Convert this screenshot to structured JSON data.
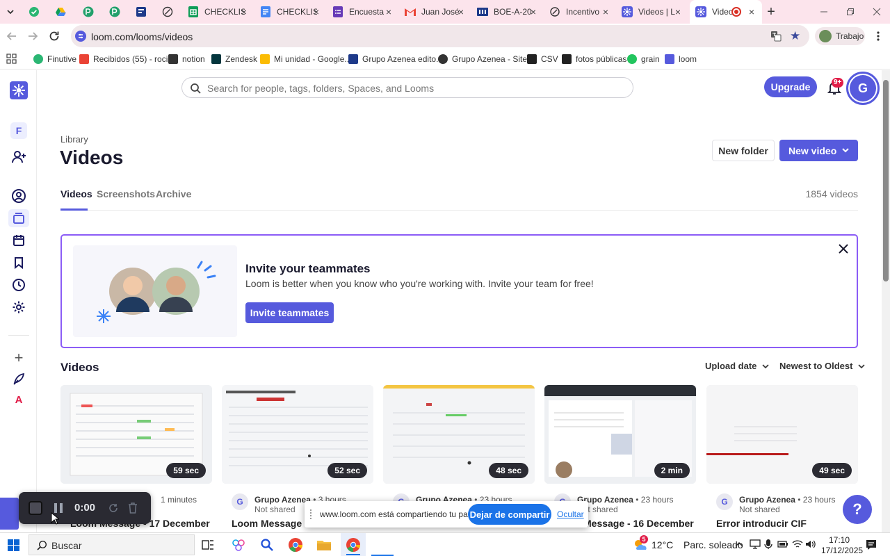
{
  "browser": {
    "tabs": [
      {
        "title": "CHECKLIS",
        "icon": "sheets-icon",
        "color": "#0f9d58"
      },
      {
        "title": "CHECKLIS",
        "icon": "docs-icon",
        "color": "#4285f4"
      },
      {
        "title": "Encuesta",
        "icon": "forms-icon",
        "color": "#673ab7"
      },
      {
        "title": "Juan José",
        "icon": "gmail-icon",
        "color": "#ea4335"
      },
      {
        "title": "BOE-A-20",
        "icon": "boe-icon",
        "color": "#1e3a8a"
      },
      {
        "title": "Incentivo",
        "icon": "globe-icon",
        "color": "#333333"
      },
      {
        "title": "Videos | L",
        "icon": "loom-icon",
        "color": "#565ADD"
      },
      {
        "title": "Video",
        "icon": "loom-icon",
        "color": "#565ADD",
        "active": true
      }
    ],
    "url": "loom.com/looms/videos",
    "profile_label": "Trabajo",
    "bookmarks": [
      {
        "label": "Finutive",
        "color": "#2bb673"
      },
      {
        "label": "Recibidos (55) - roci...",
        "color": "#ea4335"
      },
      {
        "label": "notion",
        "color": "#333333"
      },
      {
        "label": "Zendesk",
        "color": "#03363d"
      },
      {
        "label": "Mi unidad - Google...",
        "color": "#fbbc04"
      },
      {
        "label": "Grupo Azenea edito...",
        "color": "#1e3a8a"
      },
      {
        "label": "Grupo Azenea - Site...",
        "color": "#333333"
      },
      {
        "label": "CSV",
        "color": "#222222"
      },
      {
        "label": "fotos públicas",
        "color": "#222222"
      },
      {
        "label": "grain",
        "color": "#22c55e"
      },
      {
        "label": "loom",
        "color": "#565ADD"
      }
    ]
  },
  "loom": {
    "search_placeholder": "Search for people, tags, folders, Spaces, and Looms",
    "upgrade_label": "Upgrade",
    "notification_badge": "9+",
    "avatar_letter": "G",
    "workspace_letter": "F",
    "rail_letter": "A",
    "breadcrumb": "Library",
    "page_title": "Videos",
    "new_folder_label": "New folder",
    "new_video_label": "New video",
    "tabs": [
      "Videos",
      "Screenshots",
      "Archive"
    ],
    "video_count": "1854 videos",
    "invite": {
      "heading": "Invite your teammates",
      "body": "Loom is better when you know who you're working with. Invite your team for free!",
      "button": "Invite teammates"
    },
    "section_title": "Videos",
    "sort_field": "Upload date",
    "sort_order": "Newest to Oldest",
    "videos": [
      {
        "duration": "59 sec",
        "owner": "",
        "age": "1 minutes",
        "shared": "",
        "title": "Loom Message - 17 December"
      },
      {
        "duration": "52 sec",
        "owner": "Grupo Azenea",
        "age": "3 hours",
        "shared": "Not shared",
        "title": "Loom Message - 17"
      },
      {
        "duration": "48 sec",
        "owner": "Grupo Azenea",
        "age": "23 hours",
        "shared": "",
        "title": ""
      },
      {
        "duration": "2 min",
        "owner": "Grupo Azenea",
        "age": "23 hours",
        "shared": "Not shared",
        "title": "Message - 16 December"
      },
      {
        "duration": "49 sec",
        "owner": "Grupo Azenea",
        "age": "23 hours",
        "shared": "Not shared",
        "title": "Error introducir CIF"
      }
    ],
    "help_label": "?"
  },
  "recorder": {
    "time": "0:00"
  },
  "share_bar": {
    "message": "www.loom.com está compartiendo tu pantalla.",
    "stop_label": "Dejar de compartir",
    "hide_label": "Ocultar"
  },
  "taskbar": {
    "search_placeholder": "Buscar",
    "weather_temp": "12°C",
    "weather_desc": "Parc. soleado",
    "time": "17:10",
    "date": "17/12/2025",
    "weather_badge": "5"
  }
}
